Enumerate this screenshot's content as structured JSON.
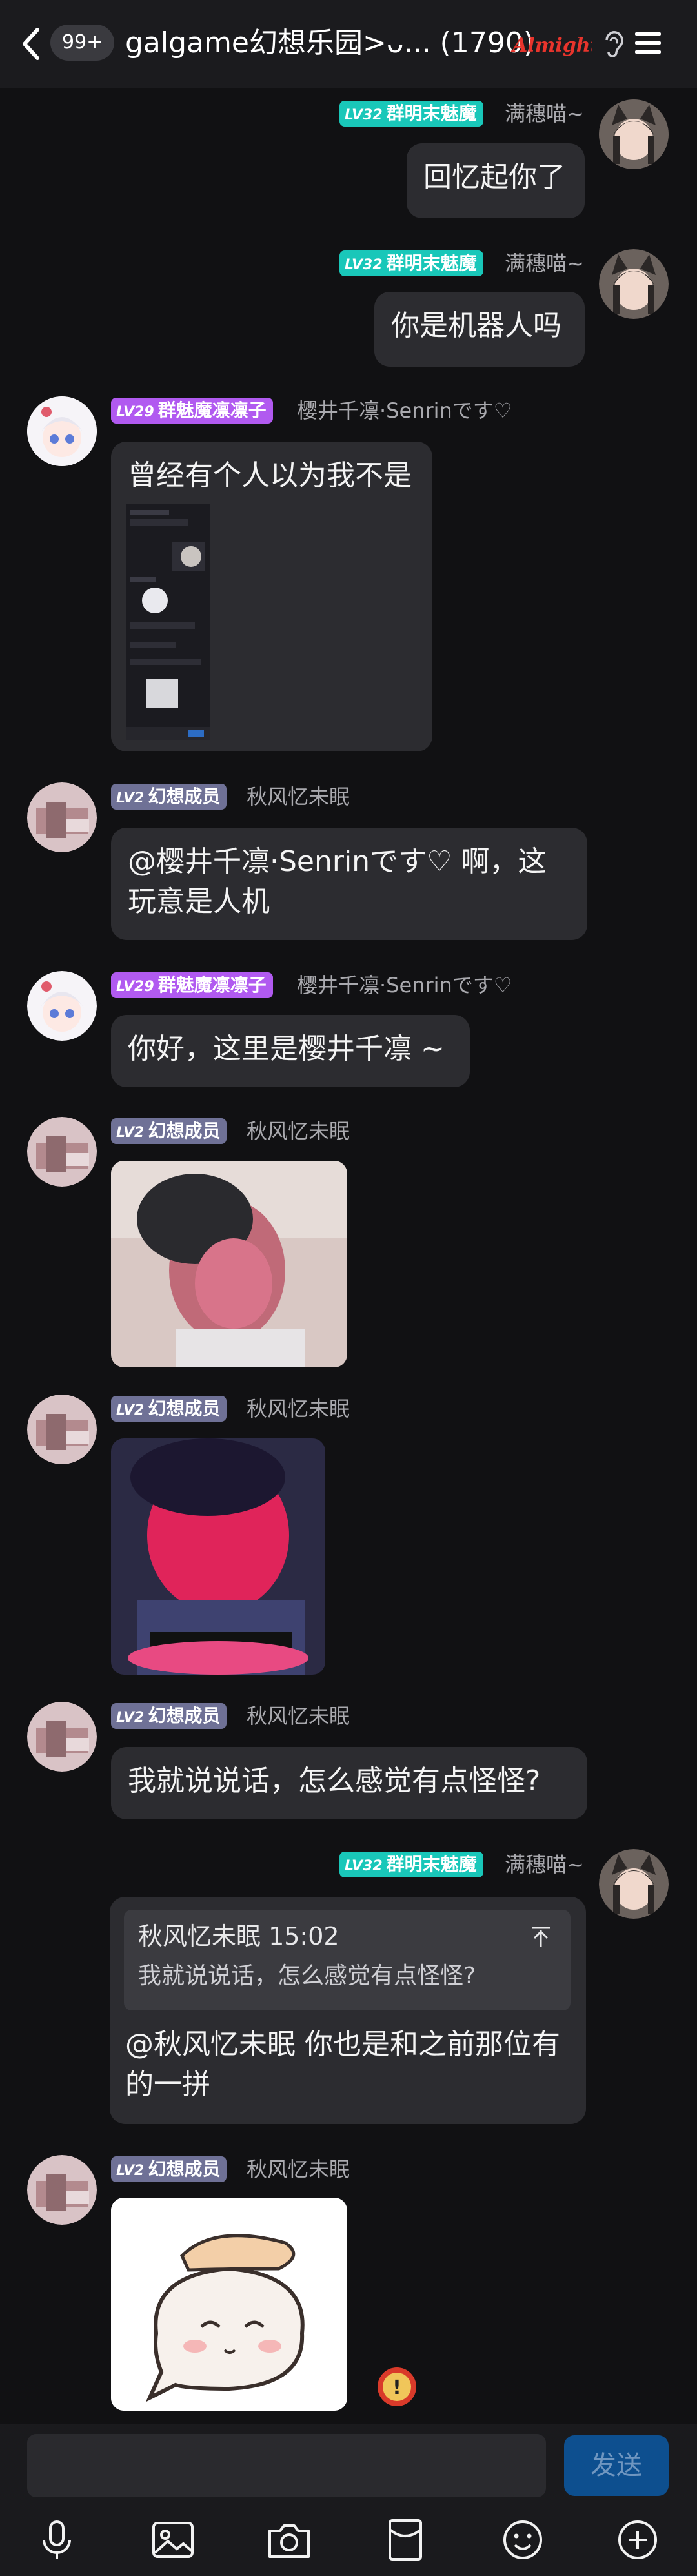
{
  "header": {
    "unread_count": "99+",
    "title": "galgame幻想乐园>ᴗ... (1790)",
    "brand_text": "Almighty"
  },
  "messages": [
    {
      "badge_level": "LV32",
      "badge_title": "群明末魅魔",
      "nickname": "满穗喵~",
      "text": "回忆起你了"
    },
    {
      "badge_level": "LV32",
      "badge_title": "群明末魅魔",
      "nickname": "满穗喵~",
      "text": "你是机器人吗"
    },
    {
      "badge_level": "LV29",
      "badge_title": "群魅魔凛凛子",
      "nickname": "樱井千凛·Senrinです♡",
      "text": "曾经有个人以为我不是"
    },
    {
      "badge_level": "LV2",
      "badge_title": "幻想成员",
      "nickname": "秋风忆未眠",
      "text": "@樱井千凛·Senrinです♡ 啊，这玩意是人机"
    },
    {
      "badge_level": "LV29",
      "badge_title": "群魅魔凛凛子",
      "nickname": "樱井千凛·Senrinです♡",
      "text": "你好，这里是樱井千凛 ~"
    },
    {
      "badge_level": "LV2",
      "badge_title": "幻想成员",
      "nickname": "秋风忆未眠"
    },
    {
      "badge_level": "LV2",
      "badge_title": "幻想成员",
      "nickname": "秋风忆未眠"
    },
    {
      "badge_level": "LV2",
      "badge_title": "幻想成员",
      "nickname": "秋风忆未眠",
      "text": "我就说说话，怎么感觉有点怪怪?"
    },
    {
      "badge_level": "LV32",
      "badge_title": "群明末魅魔",
      "nickname": "满穗喵~",
      "quote_header": "秋风忆未眠 15:02",
      "quote_text": "我就说说话，怎么感觉有点怪怪?",
      "text": "@秋风忆未眠 你也是和之前那位有的一拼"
    },
    {
      "badge_level": "LV2",
      "badge_title": "幻想成员",
      "nickname": "秋风忆未眠"
    }
  ],
  "input": {
    "placeholder": "",
    "send_label": "发送"
  },
  "toolbar": [
    "microphone-icon",
    "image-icon",
    "camera-icon",
    "red-packet-icon",
    "emoji-icon",
    "plus-icon"
  ],
  "colors": {
    "accent": "#19c7b9",
    "background": "#111113",
    "bubble": "#2c2c30",
    "send": "#0d4f8f"
  }
}
